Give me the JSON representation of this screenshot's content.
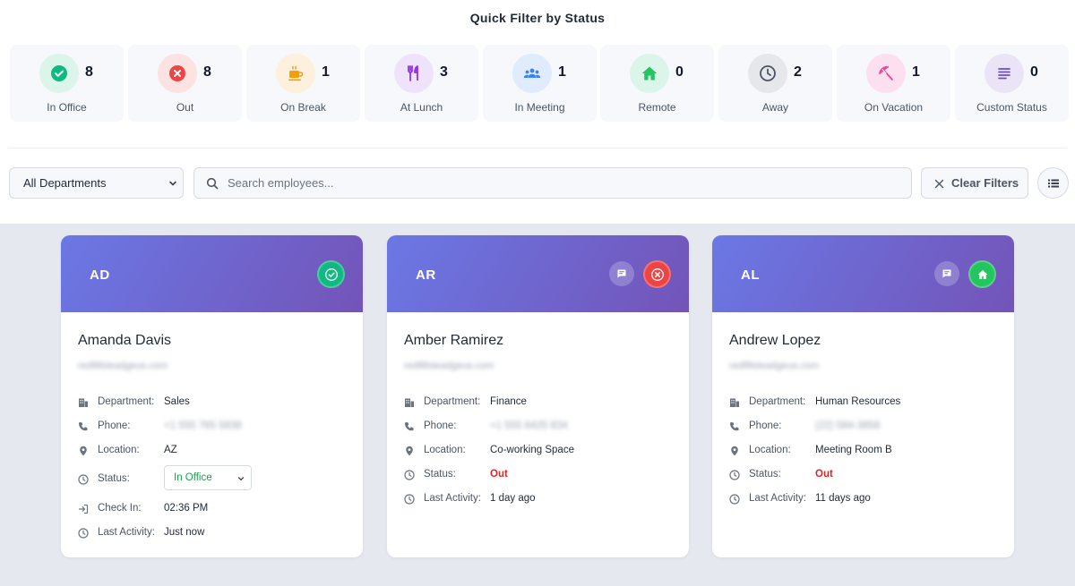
{
  "quick_filter": {
    "title": "Quick Filter by Status",
    "stats": [
      {
        "label": "In Office",
        "count": "8",
        "icon": "check-circle-icon",
        "bg": "#dcf5ea",
        "fg": "#10b981"
      },
      {
        "label": "Out",
        "count": "8",
        "icon": "x-circle-icon",
        "bg": "#fde2e2",
        "fg": "#ef4444"
      },
      {
        "label": "On Break",
        "count": "1",
        "icon": "coffee-icon",
        "bg": "#fdf0dc",
        "fg": "#f59e0b"
      },
      {
        "label": "At Lunch",
        "count": "3",
        "icon": "utensils-icon",
        "bg": "#efe3fc",
        "fg": "#9333ea"
      },
      {
        "label": "In Meeting",
        "count": "1",
        "icon": "users-icon",
        "bg": "#e0ebfc",
        "fg": "#3b82f6"
      },
      {
        "label": "Remote",
        "count": "0",
        "icon": "home-icon",
        "bg": "#dcf5ea",
        "fg": "#22c55e"
      },
      {
        "label": "Away",
        "count": "2",
        "icon": "clock-icon",
        "bg": "#e5e7eb",
        "fg": "#4b5563"
      },
      {
        "label": "On Vacation",
        "count": "1",
        "icon": "umbrella-icon",
        "bg": "#fce0ef",
        "fg": "#ec4899"
      },
      {
        "label": "Custom Status",
        "count": "0",
        "icon": "list-lines-icon",
        "bg": "#ebe4f7",
        "fg": "#6d4fc2"
      }
    ]
  },
  "filters": {
    "department_selected": "All Departments",
    "search_placeholder": "Search employees...",
    "clear_label": "Clear Filters"
  },
  "labels": {
    "department": "Department:",
    "phone": "Phone:",
    "location": "Location:",
    "status": "Status:",
    "check_in": "Check In:",
    "last_activity": "Last Activity:"
  },
  "employees": [
    {
      "initials": "AD",
      "name": "Amanda Davis",
      "email": "redfillsleadgeus.com",
      "department": "Sales",
      "phone": "+1 555 765 5838",
      "location": "AZ",
      "status": "In Office",
      "check_in": "02:36 PM",
      "last_activity": "Just now",
      "status_color": "#16a34a"
    },
    {
      "initials": "AR",
      "name": "Amber Ramirez",
      "email": "redfillsleadgeus.com",
      "department": "Finance",
      "phone": "+1 555 6425 834",
      "location": "Co-working Space",
      "status": "Out",
      "last_activity": "1 day ago",
      "status_color": "#ef4444"
    },
    {
      "initials": "AL",
      "name": "Andrew Lopez",
      "email": "redfillsleadgeus.com",
      "department": "Human Resources",
      "phone": "(22) 584-3858",
      "location": "Meeting Room B",
      "status": "Out",
      "last_activity": "11 days ago",
      "status_color": "#22c55e"
    }
  ]
}
